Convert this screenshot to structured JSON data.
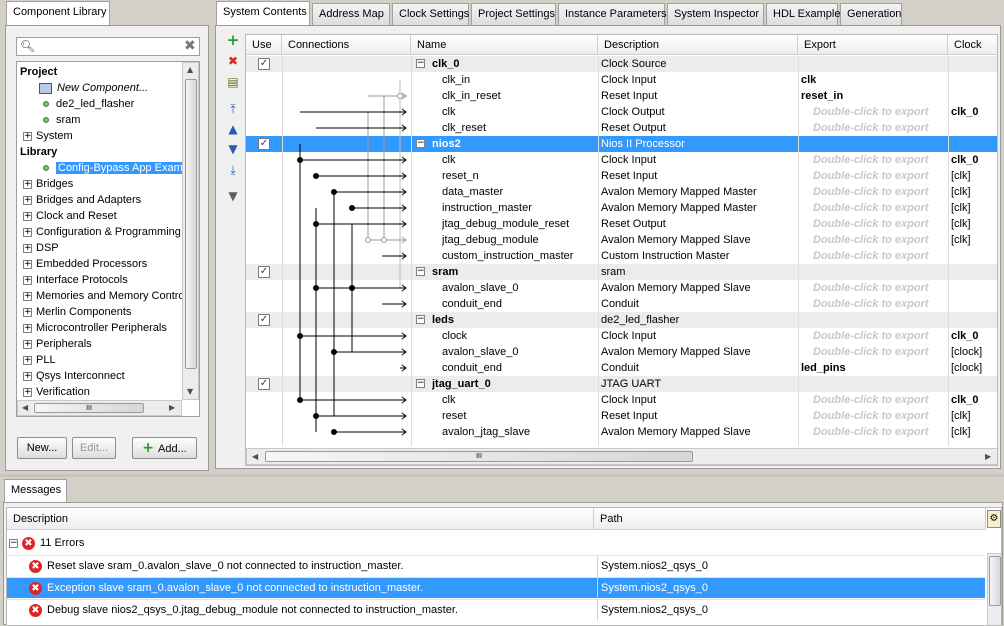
{
  "left_panel": {
    "tab": "Component Library",
    "search_placeholder": "",
    "tree": [
      {
        "label": "Project",
        "kind": "group"
      },
      {
        "label": "New Component...",
        "kind": "new"
      },
      {
        "label": "de2_led_flasher",
        "kind": "leaf"
      },
      {
        "label": "sram",
        "kind": "leaf"
      },
      {
        "label": "System",
        "kind": "folder"
      },
      {
        "label": "Library",
        "kind": "group"
      },
      {
        "label": "Config-Bypass App Exam",
        "kind": "selected-leaf"
      },
      {
        "label": "Bridges",
        "kind": "folder"
      },
      {
        "label": "Bridges and Adapters",
        "kind": "folder"
      },
      {
        "label": "Clock and Reset",
        "kind": "folder"
      },
      {
        "label": "Configuration & Programming",
        "kind": "folder"
      },
      {
        "label": "DSP",
        "kind": "folder"
      },
      {
        "label": "Embedded Processors",
        "kind": "folder"
      },
      {
        "label": "Interface Protocols",
        "kind": "folder"
      },
      {
        "label": "Memories and Memory Contro",
        "kind": "folder"
      },
      {
        "label": "Merlin Components",
        "kind": "folder"
      },
      {
        "label": "Microcontroller Peripherals",
        "kind": "folder"
      },
      {
        "label": "Peripherals",
        "kind": "folder"
      },
      {
        "label": "PLL",
        "kind": "folder"
      },
      {
        "label": "Qsys Interconnect",
        "kind": "folder"
      },
      {
        "label": "Verification",
        "kind": "folder"
      }
    ],
    "hscroll_grip": "III",
    "buttons": {
      "new": "New...",
      "edit": "Edit...",
      "add": "Add..."
    }
  },
  "tabs": [
    "System Contents",
    "Address Map",
    "Clock Settings",
    "Project Settings",
    "Instance Parameters",
    "System Inspector",
    "HDL Example",
    "Generation"
  ],
  "table": {
    "headers": {
      "use": "Use",
      "connections": "Connections",
      "name": "Name",
      "description": "Description",
      "export": "Export",
      "clock": "Clock"
    },
    "rows": [
      {
        "type": "module",
        "name": "clk_0",
        "desc": "Clock Source",
        "export": "",
        "clock": "",
        "use": true
      },
      {
        "type": "port",
        "name": "clk_in",
        "desc": "Clock Input",
        "export": "clk",
        "clock": ""
      },
      {
        "type": "port",
        "name": "clk_in_reset",
        "desc": "Reset Input",
        "export": "reset_in",
        "clock": ""
      },
      {
        "type": "port",
        "name": "clk",
        "desc": "Clock Output",
        "export": "Double-click to export",
        "clock": "clk_0"
      },
      {
        "type": "port",
        "name": "clk_reset",
        "desc": "Reset Output",
        "export": "Double-click to export",
        "clock": ""
      },
      {
        "type": "module",
        "name": "nios2",
        "desc": "Nios II Processor",
        "export": "",
        "clock": "",
        "use": true,
        "selected": true
      },
      {
        "type": "port",
        "name": "clk",
        "desc": "Clock Input",
        "export": "Double-click to export",
        "clock": "clk_0"
      },
      {
        "type": "port",
        "name": "reset_n",
        "desc": "Reset Input",
        "export": "Double-click to export",
        "clock": "[clk]"
      },
      {
        "type": "port",
        "name": "data_master",
        "desc": "Avalon Memory Mapped Master",
        "export": "Double-click to export",
        "clock": "[clk]"
      },
      {
        "type": "port",
        "name": "instruction_master",
        "desc": "Avalon Memory Mapped Master",
        "export": "Double-click to export",
        "clock": "[clk]"
      },
      {
        "type": "port",
        "name": "jtag_debug_module_reset",
        "desc": "Reset Output",
        "export": "Double-click to export",
        "clock": "[clk]"
      },
      {
        "type": "port",
        "name": "jtag_debug_module",
        "desc": "Avalon Memory Mapped Slave",
        "export": "Double-click to export",
        "clock": "[clk]"
      },
      {
        "type": "port",
        "name": "custom_instruction_master",
        "desc": "Custom Instruction Master",
        "export": "Double-click to export",
        "clock": ""
      },
      {
        "type": "module",
        "name": "sram",
        "desc": "sram",
        "export": "",
        "clock": "",
        "use": true
      },
      {
        "type": "port",
        "name": "avalon_slave_0",
        "desc": "Avalon Memory Mapped Slave",
        "export": "Double-click to export",
        "clock": ""
      },
      {
        "type": "port",
        "name": "conduit_end",
        "desc": "Conduit",
        "export": "Double-click to export",
        "clock": ""
      },
      {
        "type": "module",
        "name": "leds",
        "desc": "de2_led_flasher",
        "export": "",
        "clock": "",
        "use": true
      },
      {
        "type": "port",
        "name": "clock",
        "desc": "Clock Input",
        "export": "Double-click to export",
        "clock": "clk_0"
      },
      {
        "type": "port",
        "name": "avalon_slave_0",
        "desc": "Avalon Memory Mapped Slave",
        "export": "Double-click to export",
        "clock": "[clock]"
      },
      {
        "type": "port",
        "name": "conduit_end",
        "desc": "Conduit",
        "export": "led_pins",
        "clock": "[clock]"
      },
      {
        "type": "module",
        "name": "jtag_uart_0",
        "desc": "JTAG UART",
        "export": "",
        "clock": "",
        "use": true
      },
      {
        "type": "port",
        "name": "clk",
        "desc": "Clock Input",
        "export": "Double-click to export",
        "clock": "clk_0"
      },
      {
        "type": "port",
        "name": "reset",
        "desc": "Reset Input",
        "export": "Double-click to export",
        "clock": "[clk]"
      },
      {
        "type": "port",
        "name": "avalon_jtag_slave",
        "desc": "Avalon Memory Mapped Slave",
        "export": "Double-click to export",
        "clock": "[clk]"
      }
    ],
    "hscroll_grip": "III"
  },
  "messages": {
    "tab": "Messages",
    "headers": {
      "description": "Description",
      "path": "Path"
    },
    "group": "11 Errors",
    "items": [
      {
        "text": "Reset slave sram_0.avalon_slave_0 not connected to instruction_master.",
        "path": "System.nios2_qsys_0",
        "selected": false
      },
      {
        "text": "Exception slave sram_0.avalon_slave_0 not connected to instruction_master.",
        "path": "System.nios2_qsys_0",
        "selected": true
      },
      {
        "text": "Debug slave nios2_qsys_0.jtag_debug_module not connected to instruction_master.",
        "path": "System.nios2_qsys_0",
        "selected": false
      }
    ]
  },
  "colors": {
    "selection": "#3399ff",
    "module_row": "#ececec",
    "accent_error": "#d8262b"
  }
}
